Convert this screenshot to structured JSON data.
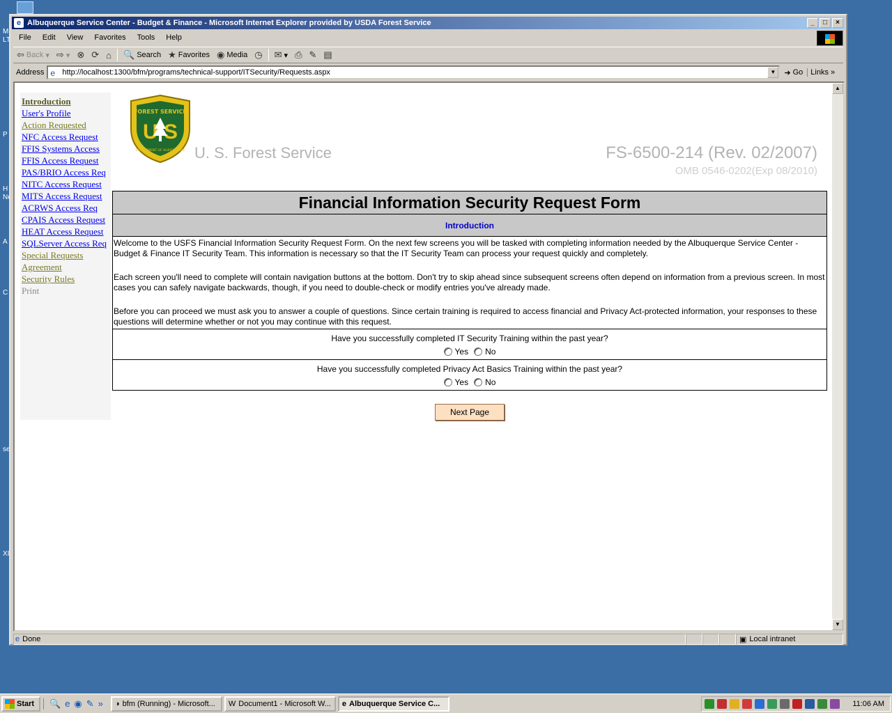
{
  "window": {
    "title": "Albuquerque Service Center - Budget & Finance - Microsoft Internet Explorer provided by USDA Forest Service"
  },
  "menu": [
    "File",
    "Edit",
    "View",
    "Favorites",
    "Tools",
    "Help"
  ],
  "toolbar": {
    "back": "Back",
    "search": "Search",
    "favorites": "Favorites",
    "media": "Media"
  },
  "address": {
    "label": "Address",
    "url": "http://localhost:1300/bfm/programs/technical-support/ITSecurity/Requests.aspx",
    "go": "Go",
    "links": "Links"
  },
  "nav": [
    {
      "label": "Introduction",
      "state": "current"
    },
    {
      "label": "User's Profile",
      "state": "link"
    },
    {
      "label": "Action Requested",
      "state": "visited"
    },
    {
      "label": "NFC Access Request",
      "state": "link"
    },
    {
      "label": "FFIS Systems Access",
      "state": "link"
    },
    {
      "label": "FFIS Access Request",
      "state": "link"
    },
    {
      "label": "PAS/BRIO Access Req",
      "state": "link"
    },
    {
      "label": "NITC Access Request",
      "state": "link"
    },
    {
      "label": "MITS Access Request",
      "state": "link"
    },
    {
      "label": "ACRWS Access Req",
      "state": "link"
    },
    {
      "label": "CPAIS Access Request",
      "state": "link"
    },
    {
      "label": "HEAT Access Request",
      "state": "link"
    },
    {
      "label": "SQLServer Access Req",
      "state": "link"
    },
    {
      "label": "Special Requests",
      "state": "visited"
    },
    {
      "label": "Agreement",
      "state": "visited"
    },
    {
      "label": "Security Rules",
      "state": "visited"
    },
    {
      "label": "Print",
      "state": "disabled"
    }
  ],
  "header": {
    "agency": "U. S. Forest Service",
    "form_number": "FS-6500-214 (Rev. 02/2007)",
    "omb": "OMB 0546-0202(Exp 08/2010)",
    "shield_text": {
      "top": "FOREST SERVICE",
      "letters": "U S",
      "bottom": "DEPARTMENT OF AGRICULTURE"
    }
  },
  "form": {
    "title": "Financial Information Security Request Form",
    "section": "Introduction",
    "paragraphs": [
      "Welcome to the USFS Financial Information Security Request Form. On the next few screens you will be tasked with completing information needed by the Albuquerque Service Center - Budget & Finance IT Security Team. This information is necessary so that the IT Security Team can process your request quickly and completely.",
      "Each screen you'll need to complete will contain navigation buttons at the bottom. Don't try to skip ahead since subsequent screens often depend on information from a previous screen. In most cases you can safely navigate backwards, though, if you need to double-check or modify entries you've already made.",
      "Before you can proceed we must ask you to answer a couple of questions. Since certain training is required to access financial and Privacy Act-protected information, your responses to these questions will determine whether or not you may continue with this request."
    ],
    "questions": [
      {
        "text": "Have you successfully completed IT Security Training within the past year?",
        "yes": "Yes",
        "no": "No"
      },
      {
        "text": "Have you successfully completed Privacy Act Basics Training within the past year?",
        "yes": "Yes",
        "no": "No"
      }
    ],
    "next_button": "Next Page"
  },
  "status": {
    "text": "Done",
    "zone": "Local intranet"
  },
  "taskbar": {
    "start": "Start",
    "tasks": [
      {
        "label": "bfm (Running) - Microsoft...",
        "active": false
      },
      {
        "label": "Document1 - Microsoft W...",
        "active": false
      },
      {
        "label": "Albuquerque Service C...",
        "active": true
      }
    ],
    "clock": "11:06 AM"
  },
  "desktop_labels": [
    "M",
    "LT",
    "P",
    "H",
    "Ne",
    "A",
    "C",
    "se",
    "XI"
  ]
}
